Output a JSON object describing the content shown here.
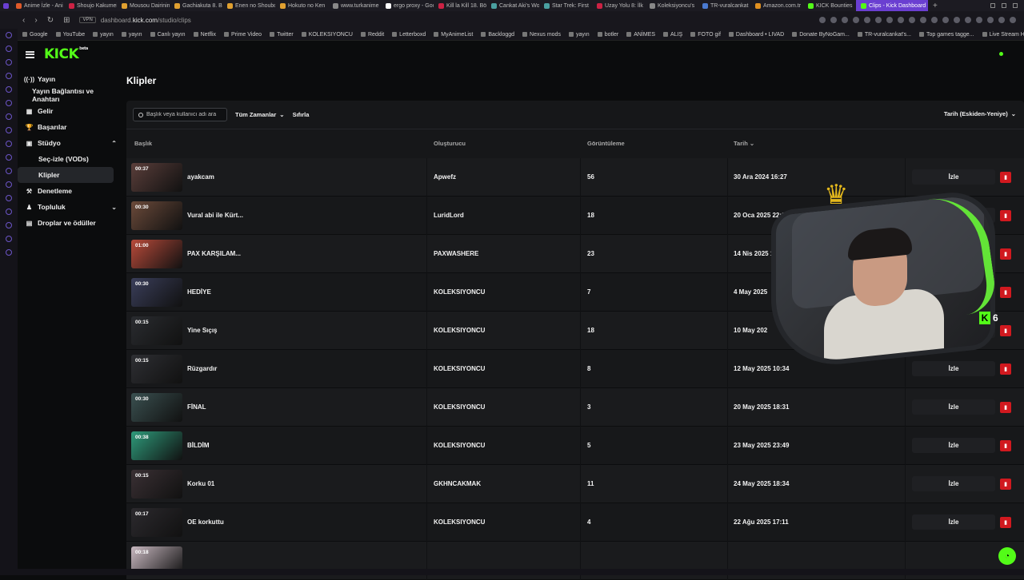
{
  "browser": {
    "tabs": [
      {
        "title": "Anime İzle - Ani",
        "color": "#e05a2a"
      },
      {
        "title": "Shoujo Kakumei",
        "color": "#cc2244"
      },
      {
        "title": "Mousou Dairinin",
        "color": "#e0a030"
      },
      {
        "title": "Gachiakuta 8. B",
        "color": "#e0a030"
      },
      {
        "title": "Enen no Shouboi",
        "color": "#e0a030"
      },
      {
        "title": "Hokuto no Ken",
        "color": "#e0a030"
      },
      {
        "title": "www.turkanime",
        "color": "#888888"
      },
      {
        "title": "ergo proxy - Goo",
        "color": "#ffffff"
      },
      {
        "title": "Kill la Kill 18. Böl",
        "color": "#cc2244"
      },
      {
        "title": "Cankat Aki's Wo",
        "color": "#4aa0a0"
      },
      {
        "title": "Star Trek: First",
        "color": "#4aa0a0"
      },
      {
        "title": "Uzay Yolu 8: İlk",
        "color": "#cc2244"
      },
      {
        "title": "Koleksiyoncu's",
        "color": "#888888"
      },
      {
        "title": "TR-vuralcankat",
        "color": "#4a7ad0"
      },
      {
        "title": "Amazon.com.tr",
        "color": "#e09020"
      },
      {
        "title": "KICK Bounties",
        "color": "#53fc18"
      },
      {
        "title": "Clips - Kick Dashboard",
        "color": "#53fc18",
        "active": true
      }
    ],
    "url_prefix": "dashboard.",
    "url_domain": "kick.com",
    "url_path": "/studio/clips",
    "vpn_label": "VPN",
    "bookmarks": [
      "Google",
      "YouTube",
      "yayın",
      "yayın",
      "Canlı yayın",
      "Netflix",
      "Prime Video",
      "Twitter",
      "KOLEKSIYONCU",
      "Reddit",
      "Letterboxd",
      "MyAnimeList",
      "Backloggd",
      "Nexus mods",
      "yayın",
      "botler",
      "ANİMES",
      "ALIŞ",
      "FOTO gif",
      "Dashboard • LIVAD",
      "Donate ByNoGam...",
      "TR-vuralcankat's...",
      "Top games tagge...",
      "Live Stream Histor..."
    ]
  },
  "app": {
    "logo": "KICK",
    "logo_sup": "beta",
    "page_title": "Klipler",
    "sidebar": [
      {
        "label": "Yayın",
        "icon": "broadcast-icon",
        "glyph": "((·))",
        "type": "item"
      },
      {
        "label": "Yayın Bağlantısı ve Anahtarı",
        "type": "plain"
      },
      {
        "label": "Gelir",
        "icon": "revenue-icon",
        "glyph": "▦",
        "type": "item"
      },
      {
        "label": "Başarılar",
        "icon": "trophy-icon",
        "glyph": "🏆",
        "type": "item"
      },
      {
        "label": "Stüdyo",
        "icon": "studio-icon",
        "glyph": "▣",
        "type": "item",
        "chevron": "⌃"
      },
      {
        "label": "Seç-izle (VODs)",
        "type": "sub"
      },
      {
        "label": "Klipler",
        "type": "sub",
        "active": true
      },
      {
        "label": "Denetleme",
        "icon": "moderation-icon",
        "glyph": "⚒",
        "type": "item"
      },
      {
        "label": "Topluluk",
        "icon": "community-icon",
        "glyph": "♟",
        "type": "item",
        "chevron": "⌄"
      },
      {
        "label": "Droplar ve ödüller",
        "icon": "drops-icon",
        "glyph": "▤",
        "type": "item"
      }
    ],
    "filters": {
      "search_placeholder": "Başlık veya kullanıcı adı ara",
      "time_filter": "Tüm Zamanlar",
      "reset": "Sıfırla",
      "sort": "Tarih (Eskiden-Yeniye)"
    },
    "columns": {
      "title": "Başlık",
      "creator": "Oluşturucu",
      "views": "Görüntüleme",
      "date": "Tarih"
    },
    "watch_label": "İzle",
    "clips": [
      {
        "duration": "00:37",
        "title": "ayakcam",
        "creator": "Apwefz",
        "views": "56",
        "date": "30 Ara 2024 16:27",
        "thumb": "#5a3e3a"
      },
      {
        "duration": "00:30",
        "title": "Vural abi ile Kürt...",
        "creator": "LuridLord",
        "views": "18",
        "date": "20 Oca 2025 22:08",
        "thumb": "#6b4a3a"
      },
      {
        "duration": "01:00",
        "title": "PAX KARŞILAM...",
        "creator": "PAXWASHERE",
        "views": "23",
        "date": "14 Nis 2025 14:",
        "thumb": "#b84a3a"
      },
      {
        "duration": "00:30",
        "title": "HEDİYE",
        "creator": "KOLEKSIYONCU",
        "views": "7",
        "date": "4 May 2025",
        "thumb": "#3a3e5a"
      },
      {
        "duration": "00:15",
        "title": "Yine Sıçış",
        "creator": "KOLEKSIYONCU",
        "views": "18",
        "date": "10 May 202",
        "thumb": "#2a2c30"
      },
      {
        "duration": "00:15",
        "title": "Rüzgardır",
        "creator": "KOLEKSIYONCU",
        "views": "8",
        "date": "12 May 2025 10:34",
        "thumb": "#2e2f33"
      },
      {
        "duration": "00:30",
        "title": "FİNAL",
        "creator": "KOLEKSIYONCU",
        "views": "3",
        "date": "20 May 2025 18:31",
        "thumb": "#3a5050"
      },
      {
        "duration": "00:38",
        "title": "BİLDİM",
        "creator": "KOLEKSIYONCU",
        "views": "5",
        "date": "23 May 2025 23:49",
        "thumb": "#2e9a7a"
      },
      {
        "duration": "00:15",
        "title": "Korku 01",
        "creator": "GKHNCAKMAK",
        "views": "11",
        "date": "24 May 2025 18:34",
        "thumb": "#3a3034"
      },
      {
        "duration": "00:17",
        "title": "OE korkuttu",
        "creator": "KOLEKSIYONCU",
        "views": "4",
        "date": "22 Ağu 2025 17:11",
        "thumb": "#2c2a2e"
      },
      {
        "duration": "00:18",
        "title": "",
        "creator": "",
        "views": "",
        "date": "",
        "thumb": "#c8b8c0"
      }
    ],
    "webcam_badge": "6",
    "webcam_badge_k": "K"
  },
  "colors": {
    "kick_green": "#53fc18",
    "delete_red": "#d1191f",
    "active_tab": "#6a3fd1"
  }
}
